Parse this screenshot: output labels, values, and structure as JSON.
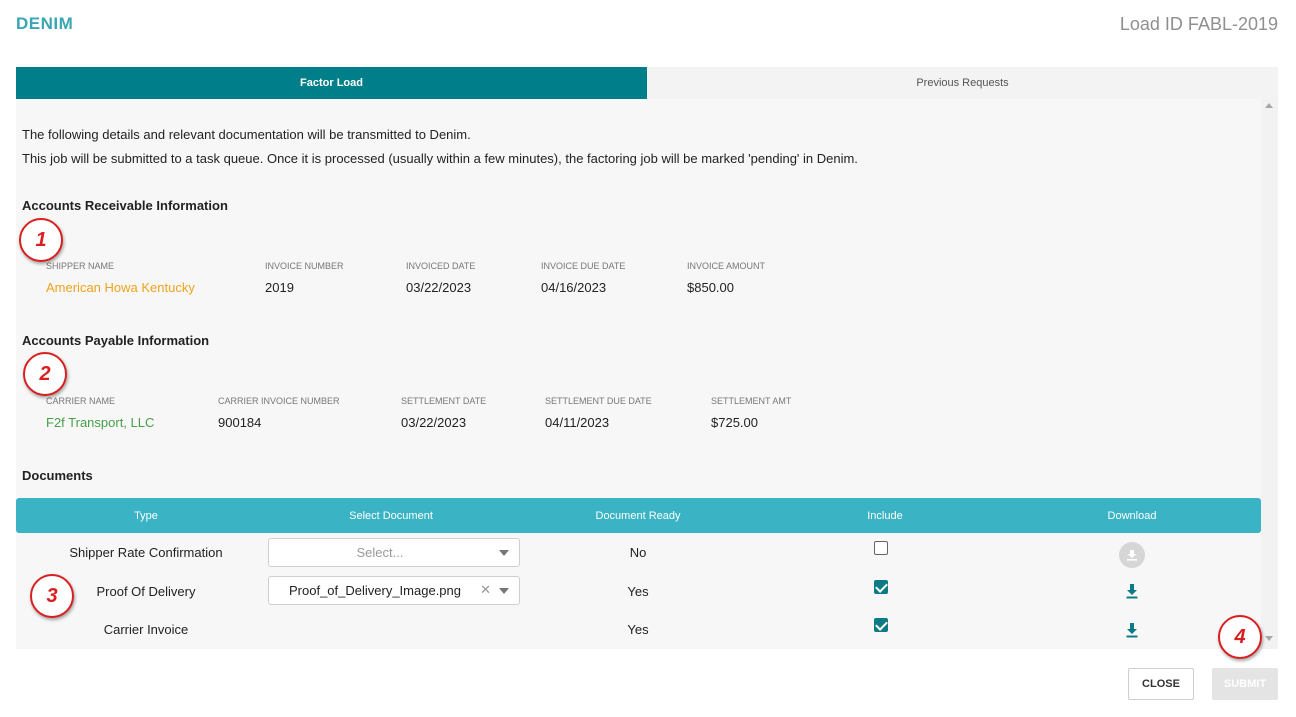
{
  "header": {
    "brand": "DENIM",
    "load_id": "Load ID FABL-2019"
  },
  "tabs": [
    {
      "label": "Factor Load",
      "active": true
    },
    {
      "label": "Previous Requests",
      "active": false
    }
  ],
  "intro": {
    "line1": "The following details and relevant documentation will be transmitted to Denim.",
    "line2": "This job will be submitted to a task queue. Once it is processed (usually within a few minutes), the factoring job will be marked 'pending' in Denim."
  },
  "receivable": {
    "title": "Accounts Receivable Information",
    "fields": [
      {
        "label": "SHIPPER NAME",
        "value": "American Howa Kentucky"
      },
      {
        "label": "INVOICE NUMBER",
        "value": "2019"
      },
      {
        "label": "INVOICED DATE",
        "value": "03/22/2023"
      },
      {
        "label": "INVOICE DUE DATE",
        "value": "04/16/2023"
      },
      {
        "label": "INVOICE AMOUNT",
        "value": "$850.00"
      }
    ]
  },
  "payable": {
    "title": "Accounts Payable Information",
    "fields": [
      {
        "label": "CARRIER NAME",
        "value": "F2f Transport, LLC"
      },
      {
        "label": "CARRIER INVOICE NUMBER",
        "value": "900184"
      },
      {
        "label": "SETTLEMENT DATE",
        "value": "03/22/2023"
      },
      {
        "label": "SETTLEMENT DUE DATE",
        "value": "04/11/2023"
      },
      {
        "label": "SETTLEMENT AMT",
        "value": "$725.00"
      }
    ]
  },
  "documents": {
    "title": "Documents",
    "columns": [
      "Type",
      "Select Document",
      "Document Ready",
      "Include",
      "Download"
    ],
    "rows": [
      {
        "type": "Shipper Rate Confirmation",
        "select_placeholder": "Select...",
        "ready": "No",
        "include": false
      },
      {
        "type": "Proof Of Delivery",
        "select_value": "Proof_of_Delivery_Image.png",
        "ready": "Yes",
        "include": true
      },
      {
        "type": "Carrier Invoice",
        "ready": "Yes",
        "include": true
      }
    ]
  },
  "markers": [
    "1",
    "2",
    "3",
    "4"
  ],
  "buttons": {
    "close": "CLOSE",
    "submit": "SUBMIT"
  },
  "colors": {
    "brand": "#3aa6b3",
    "tab_active": "#007f8b",
    "table_header": "#3ab3c4",
    "shipper_link": "#f0a21c",
    "carrier_link": "#46a046",
    "marker": "#d92020"
  },
  "icons": {
    "download": "download-icon",
    "dropdown": "chevron-down-icon",
    "clear": "close-icon"
  }
}
